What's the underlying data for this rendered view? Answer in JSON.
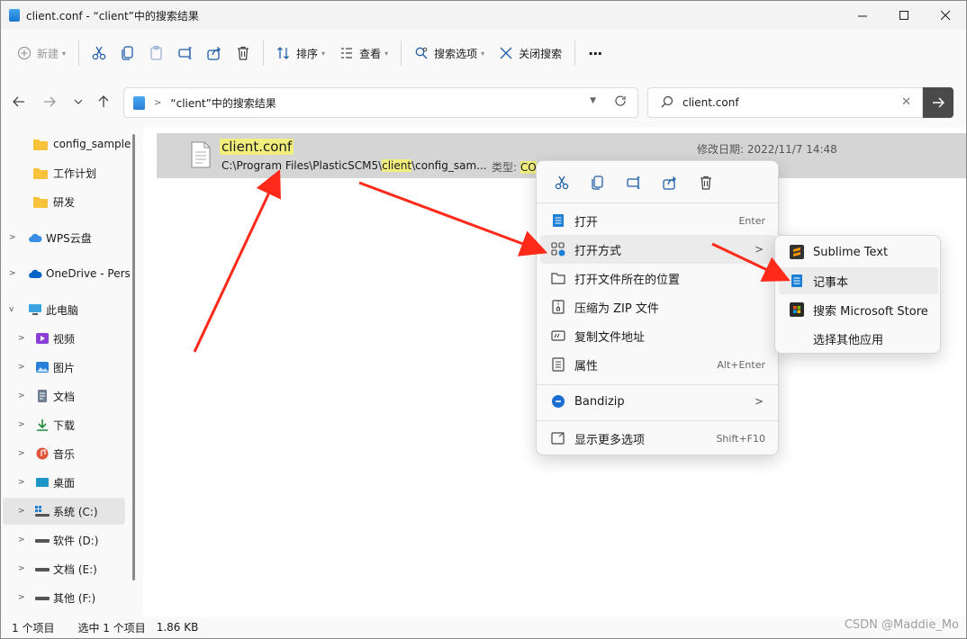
{
  "window": {
    "title": "client.conf - “client”中的搜索结果"
  },
  "toolbar": {
    "new_label": "新建",
    "sort_label": "排序",
    "view_label": "查看",
    "search_options_label": "搜索选项",
    "close_search_label": "关闭搜索",
    "more_label": "···"
  },
  "address": {
    "breadcrumb": "“client”中的搜索结果"
  },
  "search": {
    "value": "client.conf"
  },
  "sidebar": {
    "items": [
      {
        "label": "config_sample"
      },
      {
        "label": "工作计划"
      },
      {
        "label": "研发"
      },
      {
        "label": "WPS云盘"
      },
      {
        "label": "OneDrive - Pers"
      },
      {
        "label": "此电脑"
      },
      {
        "label": "视频"
      },
      {
        "label": "图片"
      },
      {
        "label": "文档"
      },
      {
        "label": "下载"
      },
      {
        "label": "音乐"
      },
      {
        "label": "桌面"
      },
      {
        "label": "系统 (C:)"
      },
      {
        "label": "软件 (D:)"
      },
      {
        "label": "文档 (E:)"
      },
      {
        "label": "其他 (F:)"
      }
    ]
  },
  "result": {
    "name": "client.conf",
    "path_before": "C:\\Program Files\\PlasticSCM5\\",
    "path_highlight": "client",
    "path_after": "\\config_sam...",
    "type_label": "类型:",
    "type_value": "CO",
    "date_label": "修改日期:",
    "date_value": "2022/11/7 14:48"
  },
  "status": {
    "count": "1 个项目",
    "selected": "选中 1 个项目",
    "size": "1.86 KB"
  },
  "watermark": "CSDN @Maddie_Mo",
  "context_menu": {
    "open": {
      "label": "打开",
      "shortcut": "Enter"
    },
    "open_with": {
      "label": "打开方式"
    },
    "open_location": {
      "label": "打开文件所在的位置"
    },
    "compress": {
      "label": "压缩为 ZIP 文件"
    },
    "copy_path": {
      "label": "复制文件地址"
    },
    "properties": {
      "label": "属性",
      "shortcut": "Alt+Enter"
    },
    "bandizip": {
      "label": "Bandizip"
    },
    "more_options": {
      "label": "显示更多选项",
      "shortcut": "Shift+F10"
    }
  },
  "submenu": {
    "items": [
      {
        "label": "Sublime Text"
      },
      {
        "label": "记事本"
      },
      {
        "label": "搜索 Microsoft Store"
      },
      {
        "label": "选择其他应用"
      }
    ]
  },
  "colors": {
    "highlight": "#f1ee7e",
    "arrow": "#ff2a1a",
    "accent": "#0067c0"
  }
}
